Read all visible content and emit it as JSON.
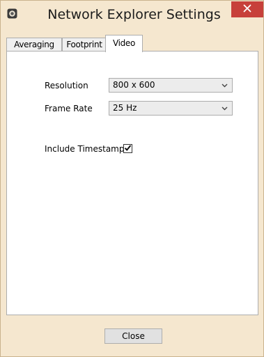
{
  "window": {
    "title": "Network Explorer Settings"
  },
  "tabs": [
    {
      "label": "Averaging",
      "active": false
    },
    {
      "label": "Footprint",
      "active": false
    },
    {
      "label": "Video",
      "active": true
    }
  ],
  "video": {
    "resolution": {
      "label": "Resolution",
      "value": "800 x 600"
    },
    "frame_rate": {
      "label": "Frame Rate",
      "value": "25 Hz"
    },
    "include_timestamp": {
      "label": "Include Timestamp",
      "checked": true
    }
  },
  "footer": {
    "close_label": "Close"
  },
  "icons": {
    "app": "app-icon",
    "close": "close-icon",
    "dropdown": "chevron-down-icon",
    "check": "check-icon"
  },
  "colors": {
    "window_background": "#f5e7cf",
    "close_button": "#c7403a"
  }
}
